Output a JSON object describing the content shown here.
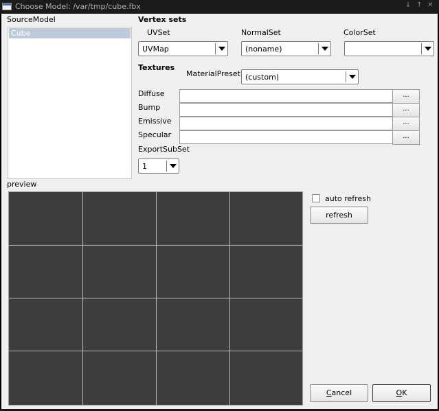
{
  "window": {
    "title": "Choose Model: /var/tmp/cube.fbx",
    "controls": [
      "↓",
      "↑",
      "✕"
    ]
  },
  "source_model": {
    "label": "SourceModel",
    "items": [
      "Cube"
    ],
    "selected": "Cube"
  },
  "vertex_sets": {
    "heading": "Vertex sets",
    "uvset": {
      "label": "UVSet",
      "value": "UVMap"
    },
    "normalset": {
      "label": "NormalSet",
      "value": "(noname)"
    },
    "colorset": {
      "label": "ColorSet",
      "value": ""
    }
  },
  "textures": {
    "heading": "Textures",
    "material_preset": {
      "label": "MaterialPreset",
      "value": "(custom)"
    },
    "fields": [
      {
        "label": "Diffuse",
        "value": "",
        "browse": "..."
      },
      {
        "label": "Bump",
        "value": "",
        "browse": "..."
      },
      {
        "label": "Emissive",
        "value": "",
        "browse": "..."
      },
      {
        "label": "Specular",
        "value": "",
        "browse": "..."
      }
    ]
  },
  "export_subset": {
    "label": "ExportSubSet",
    "value": "1"
  },
  "preview": {
    "label": "preview",
    "background": "#3d3d3d",
    "grid_color": "#b8b8b8"
  },
  "auto_refresh": {
    "label": "auto refresh",
    "checked": false
  },
  "buttons": {
    "refresh": "refresh",
    "cancel": "Cancel",
    "cancel_mnemonic": "C",
    "cancel_rest": "ancel",
    "ok": "OK",
    "ok_mnemonic": "O",
    "ok_rest": "K"
  },
  "colors": {
    "selection": "#bccadb",
    "dialog_bg": "#f0f0f0",
    "titlebar_bg": "#1b1b1b"
  }
}
